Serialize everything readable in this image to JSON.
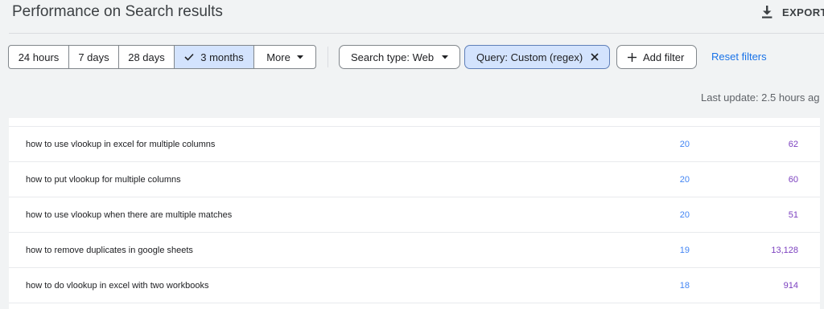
{
  "header": {
    "title": "Performance on Search results",
    "export_label": "EXPORT"
  },
  "date_range": {
    "options": [
      "24 hours",
      "7 days",
      "28 days",
      "3 months",
      "More"
    ],
    "selected": "3 months"
  },
  "filters": {
    "search_type": "Search type: Web",
    "query": "Query: Custom (regex)",
    "add_filter": "Add filter",
    "reset": "Reset filters"
  },
  "last_update": "Last update: 2.5 hours ag",
  "table": {
    "rows": [
      {
        "query": "how to use vlookup in excel for multiple columns",
        "clicks": "20",
        "impressions": "62"
      },
      {
        "query": "how to put vlookup for multiple columns",
        "clicks": "20",
        "impressions": "60"
      },
      {
        "query": "how to use vlookup when there are multiple matches",
        "clicks": "20",
        "impressions": "51"
      },
      {
        "query": "how to remove duplicates in google sheets",
        "clicks": "19",
        "impressions": "13,128"
      },
      {
        "query": "how to do vlookup in excel with two workbooks",
        "clicks": "18",
        "impressions": "914"
      }
    ]
  },
  "colors": {
    "accent": "#1a73e8",
    "selected_bg": "#d3e3fd",
    "clicks": "#4285f4",
    "impressions": "#7b3fbf"
  },
  "icons": {
    "export": "download-icon",
    "selected": "check-icon",
    "dropdown": "caret-down-icon",
    "remove": "close-icon",
    "add": "plus-icon"
  }
}
